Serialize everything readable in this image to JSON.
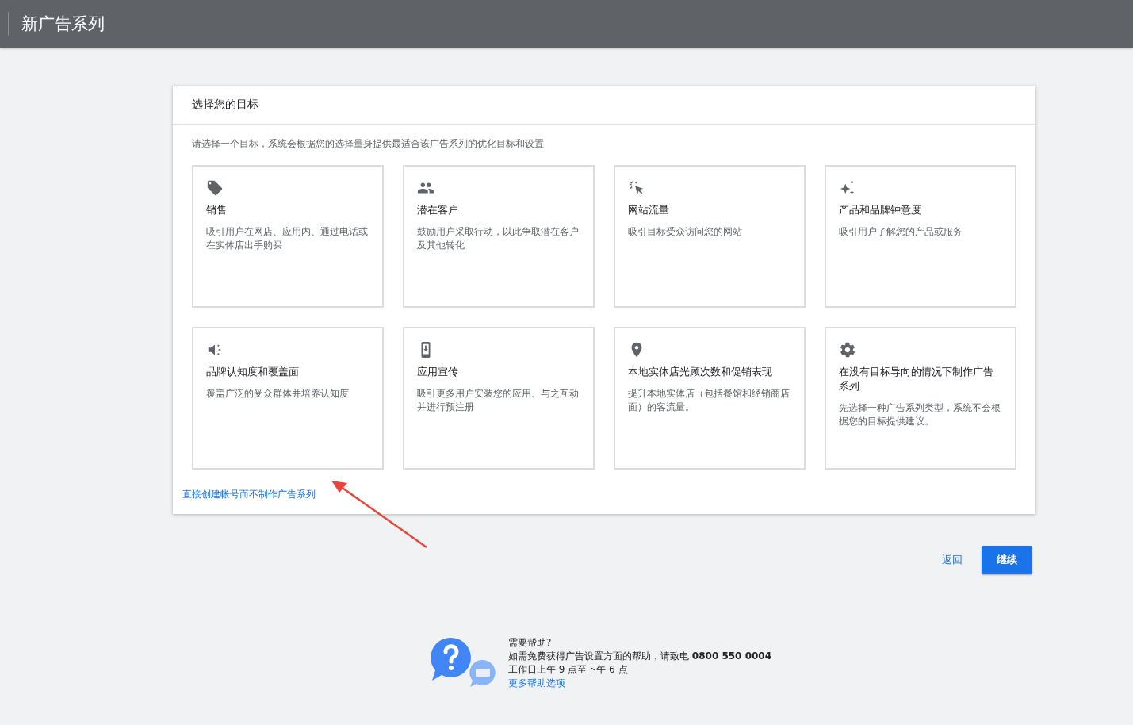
{
  "header": {
    "title": "新广告系列"
  },
  "panel": {
    "title": "选择您的目标",
    "intro": "请选择一个目标，系统会根据您的选择量身提供最适合该广告系列的优化目标和设置",
    "goals": [
      {
        "kind": "tag",
        "title": "销售",
        "description": "吸引用户在网店、应用内、通过电话或在实体店出手购买"
      },
      {
        "kind": "people",
        "title": "潜在客户",
        "description": "鼓励用户采取行动，以此争取潜在客户及其他转化"
      },
      {
        "kind": "click",
        "title": "网站流量",
        "description": "吸引目标受众访问您的网站"
      },
      {
        "kind": "sparkle",
        "title": "产品和品牌钟意度",
        "description": "吸引用户了解您的产品或服务"
      },
      {
        "kind": "speaker",
        "title": "品牌认知度和覆盖面",
        "description": "覆盖广泛的受众群体并培养认知度"
      },
      {
        "kind": "phone",
        "title": "应用宣传",
        "description": "吸引更多用户安装您的应用、与之互动并进行预注册"
      },
      {
        "kind": "pin",
        "title": "本地实体店光顾次数和促销表现",
        "description": "提升本地实体店（包括餐馆和经销商店面）的客流量。"
      },
      {
        "kind": "gear",
        "title": "在没有目标导向的情况下制作广告系列",
        "description": "先选择一种广告系列类型，系统不会根据您的目标提供建议。"
      }
    ],
    "link": "直接创建帐号而不制作广告系列"
  },
  "actions": {
    "back": "返回",
    "continue": "继续"
  },
  "help": {
    "title": "需要帮助?",
    "text": "如需免费获得广告设置方面的帮助，请致电 **0800 550 0004**",
    "hours": "工作日上午 9 点至下午 6 点",
    "link": "更多帮助选项"
  }
}
